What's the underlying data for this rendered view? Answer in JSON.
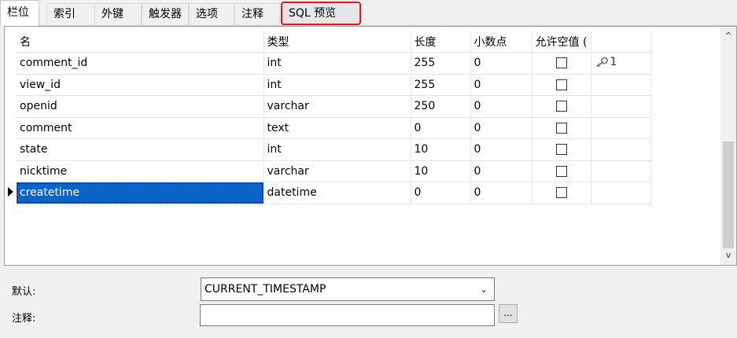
{
  "tabs": [
    {
      "label": "栏位",
      "active": true
    },
    {
      "label": "索引"
    },
    {
      "label": "外键"
    },
    {
      "label": "触发器"
    },
    {
      "label": "选项"
    },
    {
      "label": "注释"
    },
    {
      "label": "SQL 预览",
      "highlighted": true
    }
  ],
  "grid": {
    "columns": [
      "名",
      "类型",
      "长度",
      "小数点",
      "允许空值 (",
      ""
    ],
    "rows": [
      {
        "name": "comment_id",
        "type": "int",
        "length": "255",
        "decimals": "0",
        "nullable": false,
        "key": "1"
      },
      {
        "name": "view_id",
        "type": "int",
        "length": "255",
        "decimals": "0",
        "nullable": false,
        "key": ""
      },
      {
        "name": "openid",
        "type": "varchar",
        "length": "250",
        "decimals": "0",
        "nullable": false,
        "key": ""
      },
      {
        "name": "comment",
        "type": "text",
        "length": "0",
        "decimals": "0",
        "nullable": false,
        "key": ""
      },
      {
        "name": "state",
        "type": "int",
        "length": "10",
        "decimals": "0",
        "nullable": false,
        "key": ""
      },
      {
        "name": "nicktime",
        "type": "varchar",
        "length": "10",
        "decimals": "0",
        "nullable": false,
        "key": ""
      },
      {
        "name": "createtime",
        "type": "datetime",
        "length": "0",
        "decimals": "0",
        "nullable": false,
        "key": "",
        "selected": true
      }
    ]
  },
  "scrollbar": {
    "up_arrow": "^",
    "down_arrow": "v"
  },
  "properties": {
    "default_label": "默认:",
    "default_value": "CURRENT_TIMESTAMP",
    "comment_label": "注释:",
    "comment_value": "",
    "ellipsis_label": "..."
  },
  "colors": {
    "selection": "#0a64c8",
    "highlight_border": "#e0181b"
  }
}
